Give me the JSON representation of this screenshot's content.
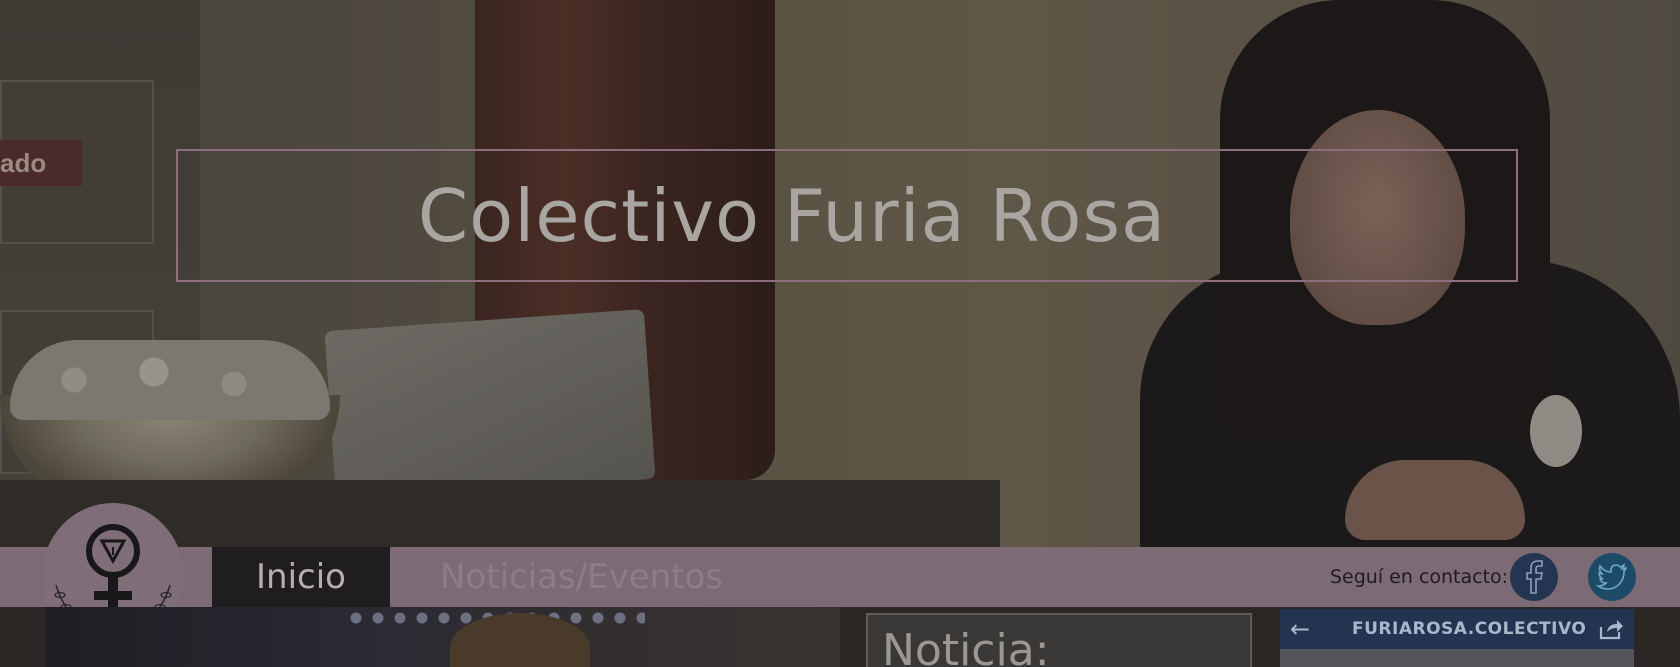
{
  "site": {
    "title": "Colectivo Furia Rosa"
  },
  "hero": {
    "sign_text": "ado"
  },
  "nav": {
    "items": [
      {
        "label": "Inicio",
        "active": true
      },
      {
        "label": "Noticias/Eventos",
        "active": false
      }
    ],
    "contact_label": "Seguí en contacto:",
    "social": [
      {
        "icon": "facebook-icon"
      },
      {
        "icon": "twitter-icon"
      }
    ]
  },
  "news": {
    "title": "Noticia:"
  },
  "facebook_widget": {
    "page_name": "FURIAROSA.COLECTIVO",
    "back_icon": "arrow-left-icon",
    "share_icon": "share-icon"
  },
  "colors": {
    "nav_bg": "#7c6a75",
    "active_tab_bg": "#1f1d1e",
    "title_frame": "#8d6e7e"
  }
}
